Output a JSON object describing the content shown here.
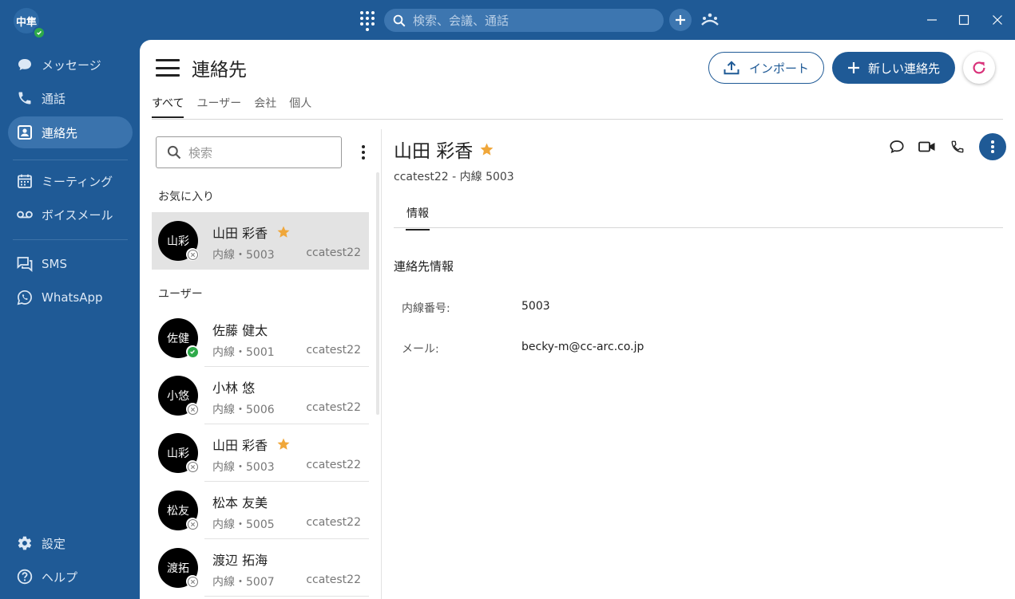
{
  "titlebar": {
    "user_initials": "中隼",
    "search_placeholder": "検索、会議、通話"
  },
  "sidebar": {
    "items": [
      {
        "label": "メッセージ",
        "icon": "chat-bubble-icon"
      },
      {
        "label": "通話",
        "icon": "phone-icon"
      },
      {
        "label": "連絡先",
        "icon": "contact-card-icon",
        "active": true
      },
      {
        "label": "ミーティング",
        "icon": "calendar-icon"
      },
      {
        "label": "ボイスメール",
        "icon": "voicemail-icon"
      },
      {
        "label": "SMS",
        "icon": "sms-icon"
      },
      {
        "label": "WhatsApp",
        "icon": "whatsapp-icon"
      }
    ],
    "bottom": [
      {
        "label": "設定",
        "icon": "gear-icon"
      },
      {
        "label": "ヘルプ",
        "icon": "help-icon"
      }
    ]
  },
  "header": {
    "title": "連絡先",
    "import_label": "インポート",
    "new_contact_label": "新しい連絡先"
  },
  "tabs": [
    "すべて",
    "ユーザー",
    "会社",
    "個人"
  ],
  "list": {
    "search_placeholder": "検索",
    "favorites_label": "お気に入り",
    "users_label": "ユーザー",
    "favorites": [
      {
        "initials": "山彩",
        "name": "山田 彩香",
        "ext": "内線・5003",
        "company": "ccatest22",
        "favorite": true,
        "online": false
      }
    ],
    "users": [
      {
        "initials": "佐健",
        "name": "佐藤 健太",
        "ext": "内線・5001",
        "company": "ccatest22",
        "favorite": false,
        "online": true
      },
      {
        "initials": "小悠",
        "name": "小林 悠",
        "ext": "内線・5006",
        "company": "ccatest22",
        "favorite": false,
        "online": false
      },
      {
        "initials": "山彩",
        "name": "山田 彩香",
        "ext": "内線・5003",
        "company": "ccatest22",
        "favorite": true,
        "online": false
      },
      {
        "initials": "松友",
        "name": "松本 友美",
        "ext": "内線・5005",
        "company": "ccatest22",
        "favorite": false,
        "online": false
      },
      {
        "initials": "渡拓",
        "name": "渡辺 拓海",
        "ext": "内線・5007",
        "company": "ccatest22",
        "favorite": false,
        "online": false
      }
    ]
  },
  "detail": {
    "name": "山田 彩香",
    "subtitle": "ccatest22 - 内線 5003",
    "tab": "情報",
    "section_title": "連絡先情報",
    "fields": [
      {
        "label": "内線番号:",
        "value": "5003"
      },
      {
        "label": "メール:",
        "value": "becky-m@cc-arc.co.jp"
      }
    ]
  },
  "colors": {
    "brand": "#1f5a96",
    "online": "#2eaa4a",
    "star": "#f0a73a",
    "refresh": "#d9327a"
  }
}
